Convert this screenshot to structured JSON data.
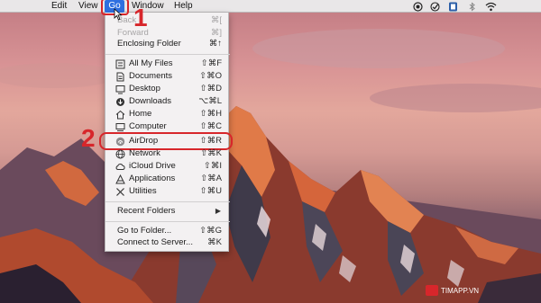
{
  "menubar": {
    "edit": "Edit",
    "view": "View",
    "go": "Go",
    "window": "Window",
    "help": "Help"
  },
  "go_menu": {
    "back": {
      "label": "Back",
      "shortcut": "⌘["
    },
    "forward": {
      "label": "Forward",
      "shortcut": "⌘]"
    },
    "enclosing_folder": {
      "label": "Enclosing Folder",
      "shortcut": "⌘↑"
    },
    "all_my_files": {
      "label": "All My Files",
      "shortcut": "⇧⌘F"
    },
    "documents": {
      "label": "Documents",
      "shortcut": "⇧⌘O"
    },
    "desktop": {
      "label": "Desktop",
      "shortcut": "⇧⌘D"
    },
    "downloads": {
      "label": "Downloads",
      "shortcut": "⌥⌘L"
    },
    "home": {
      "label": "Home",
      "shortcut": "⇧⌘H"
    },
    "computer": {
      "label": "Computer",
      "shortcut": "⇧⌘C"
    },
    "airdrop": {
      "label": "AirDrop",
      "shortcut": "⇧⌘R"
    },
    "network": {
      "label": "Network",
      "shortcut": "⇧⌘K"
    },
    "icloud_drive": {
      "label": "iCloud Drive",
      "shortcut": "⇧⌘I"
    },
    "applications": {
      "label": "Applications",
      "shortcut": "⇧⌘A"
    },
    "utilities": {
      "label": "Utilities",
      "shortcut": "⇧⌘U"
    },
    "recent_folders": {
      "label": "Recent Folders",
      "arrow": "▶"
    },
    "go_to_folder": {
      "label": "Go to Folder...",
      "shortcut": "⇧⌘G"
    },
    "connect_to_server": {
      "label": "Connect to Server...",
      "shortcut": "⌘K"
    }
  },
  "annotations": {
    "step1": "1",
    "step2": "2"
  },
  "watermark": {
    "text": "TIMAPP.VN"
  },
  "colors": {
    "highlight_red": "#d7262b",
    "menu_accent_blue": "#2f6fe0"
  }
}
